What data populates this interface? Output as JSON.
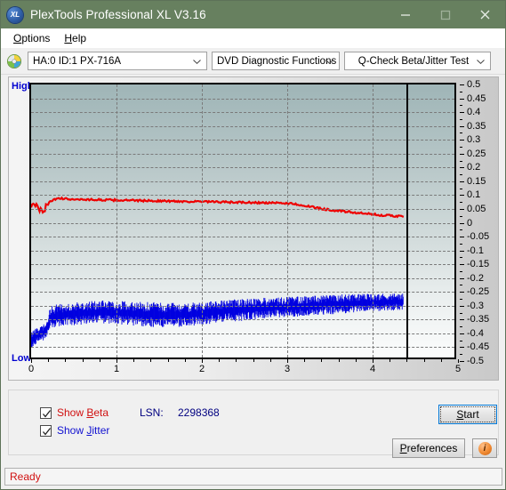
{
  "window": {
    "title": "PlexTools Professional XL V3.16",
    "icon": "XL",
    "controls": {
      "minimize": "minimize-icon",
      "maximize": "maximize-icon",
      "close": "close-icon"
    }
  },
  "menubar": {
    "items": [
      {
        "label": "Options",
        "accel": "O"
      },
      {
        "label": "Help",
        "accel": "H"
      }
    ]
  },
  "toolbar": {
    "drive_icon": "disc-icon",
    "drive_select": "HA:0 ID:1  PX-716A",
    "function_select": "DVD Diagnostic Functions",
    "test_select": "Q-Check Beta/Jitter Test"
  },
  "chart_labels": {
    "high": "High",
    "low": "Low"
  },
  "options": {
    "show_beta_label": "Show Beta",
    "show_beta_accel": "B",
    "show_beta_checked": true,
    "show_jitter_label": "Show Jitter",
    "show_jitter_accel": "J",
    "show_jitter_checked": true,
    "lsn_label": "LSN:",
    "lsn_value": "2298368",
    "start_label": "Start",
    "start_accel": "S",
    "preferences_label": "Preferences",
    "preferences_accel": "P",
    "info_icon": "info-icon"
  },
  "statusbar": {
    "text": "Ready"
  },
  "colors": {
    "titlebar": "#67805f",
    "beta_series": "#ee0000",
    "jitter_series": "#0000e0",
    "status_text": "#d01010",
    "axis_label": "#0000d0"
  },
  "chart_data": {
    "type": "line",
    "title": "Q-Check Beta/Jitter Test",
    "xlabel": "",
    "ylabel": "",
    "xlim": [
      0,
      5
    ],
    "ylim": [
      -0.5,
      0.5
    ],
    "grid": true,
    "legend_position": "external-bottom",
    "x_ticks": [
      0,
      1,
      2,
      3,
      4,
      5
    ],
    "y_ticks": [
      0.5,
      0.45,
      0.4,
      0.35,
      0.3,
      0.25,
      0.2,
      0.15,
      0.1,
      0.05,
      0,
      -0.05,
      -0.1,
      -0.15,
      -0.2,
      -0.25,
      -0.3,
      -0.35,
      -0.4,
      -0.45,
      -0.5
    ],
    "y_left_labels": [
      "High",
      "Low"
    ],
    "data_end_x": 4.4,
    "marker_line_x": 4.4,
    "series": [
      {
        "name": "Show Beta",
        "color": "#ee0000",
        "kind": "line",
        "x": [
          0.0,
          0.03,
          0.06,
          0.09,
          0.12,
          0.15,
          0.18,
          0.22,
          0.28,
          0.36,
          0.46,
          0.58,
          0.72,
          0.88,
          1.05,
          1.22,
          1.4,
          1.58,
          1.76,
          1.94,
          2.12,
          2.3,
          2.48,
          2.66,
          2.84,
          3.02,
          3.1,
          3.2,
          3.3,
          3.45,
          3.6,
          3.75,
          3.9,
          4.05,
          4.2,
          4.32,
          4.4
        ],
        "y": [
          0.06,
          0.052,
          0.058,
          0.04,
          0.05,
          0.035,
          0.055,
          0.078,
          0.08,
          0.082,
          0.08,
          0.079,
          0.078,
          0.077,
          0.076,
          0.075,
          0.074,
          0.073,
          0.072,
          0.071,
          0.07,
          0.069,
          0.068,
          0.067,
          0.066,
          0.065,
          0.063,
          0.058,
          0.052,
          0.044,
          0.038,
          0.033,
          0.028,
          0.024,
          0.02,
          0.018,
          0.016
        ]
      },
      {
        "name": "Show Jitter",
        "color": "#0000e0",
        "kind": "noise-band",
        "x": [
          0.0,
          0.05,
          0.1,
          0.14,
          0.18,
          0.22,
          0.3,
          0.45,
          0.65,
          0.85,
          1.0,
          1.2,
          1.4,
          1.6,
          1.8,
          2.0,
          2.2,
          2.4,
          2.6,
          2.8,
          3.0,
          3.2,
          3.4,
          3.6,
          3.8,
          4.0,
          4.2,
          4.4
        ],
        "y_upper": [
          -0.42,
          -0.405,
          -0.4,
          -0.392,
          -0.388,
          -0.33,
          -0.322,
          -0.318,
          -0.312,
          -0.308,
          -0.31,
          -0.314,
          -0.316,
          -0.318,
          -0.318,
          -0.314,
          -0.308,
          -0.304,
          -0.3,
          -0.296,
          -0.294,
          -0.29,
          -0.288,
          -0.284,
          -0.282,
          -0.28,
          -0.278,
          -0.278
        ],
        "y_lower": [
          -0.455,
          -0.44,
          -0.432,
          -0.428,
          -0.424,
          -0.378,
          -0.372,
          -0.366,
          -0.362,
          -0.358,
          -0.36,
          -0.366,
          -0.37,
          -0.372,
          -0.37,
          -0.364,
          -0.356,
          -0.352,
          -0.346,
          -0.34,
          -0.338,
          -0.334,
          -0.33,
          -0.326,
          -0.322,
          -0.318,
          -0.316,
          -0.314
        ]
      }
    ]
  }
}
